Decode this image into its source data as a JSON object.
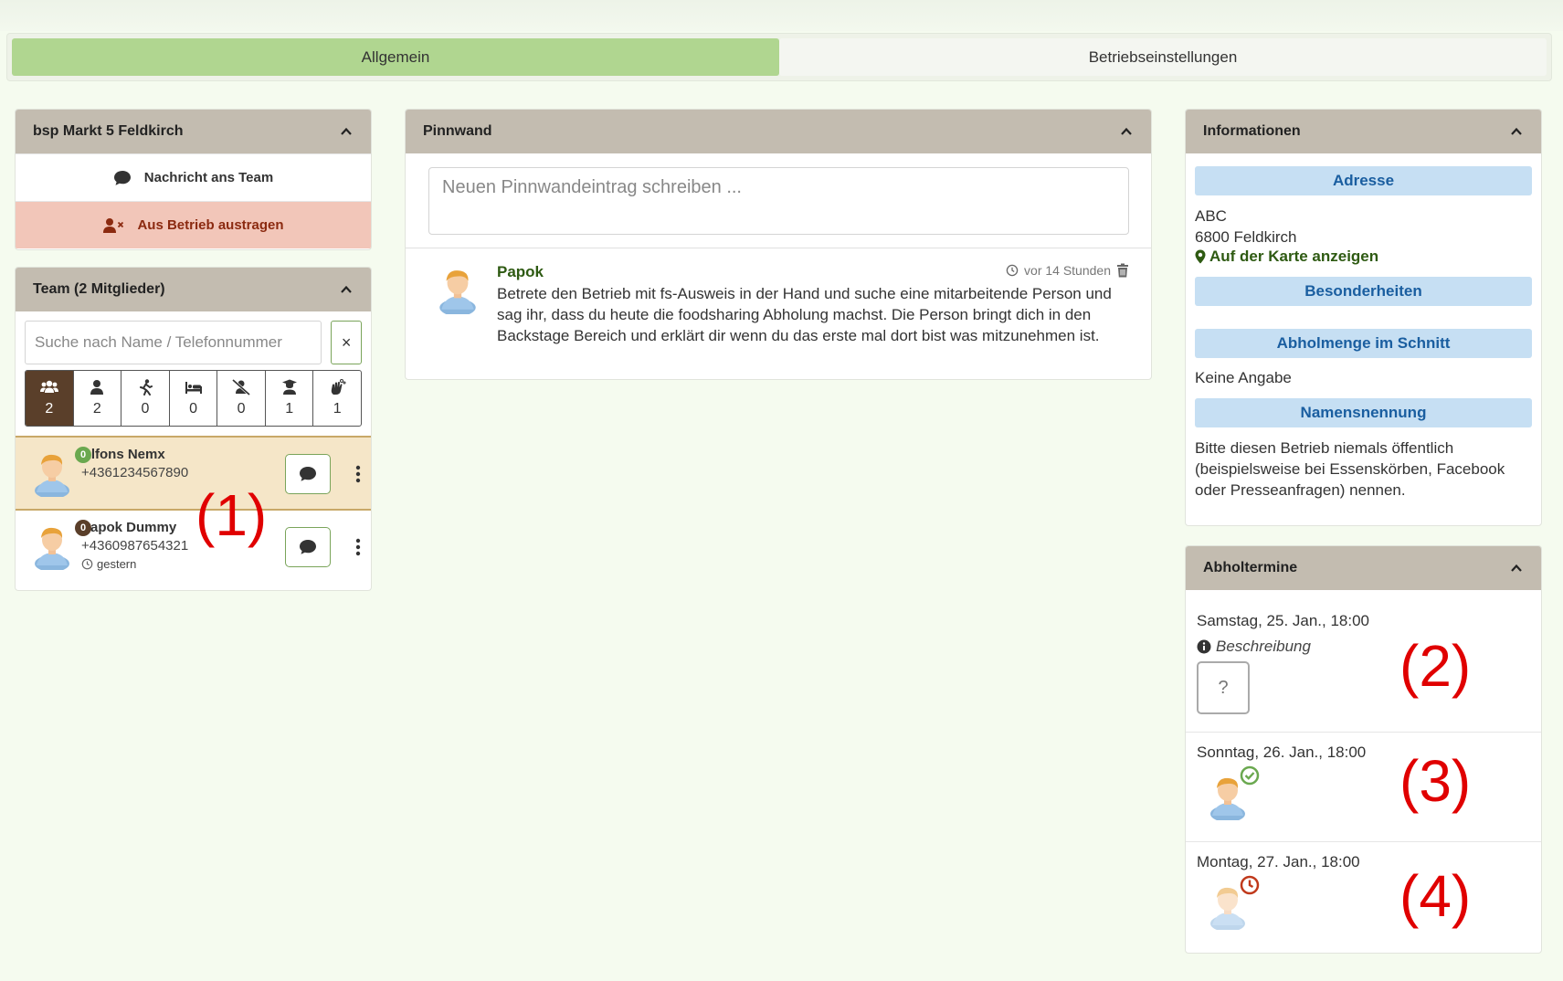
{
  "tabs": [
    {
      "label": "Allgemein",
      "active": true
    },
    {
      "label": "Betriebseinstellungen",
      "active": false
    }
  ],
  "store_panel": {
    "title": "bsp Markt 5 Feldkirch",
    "message_team": "Nachricht ans Team",
    "leave_store": "Aus Betrieb austragen"
  },
  "team_panel": {
    "title": "Team (2 Mitglieder)",
    "search_placeholder": "Suche nach Name / Telefonnummer",
    "clear_label": "×",
    "filters": [
      {
        "icon": "group-icon",
        "count": "2",
        "active": true
      },
      {
        "icon": "person-icon",
        "count": "2",
        "active": false
      },
      {
        "icon": "running-icon",
        "count": "0",
        "active": false
      },
      {
        "icon": "bed-icon",
        "count": "0",
        "active": false
      },
      {
        "icon": "user-slash-icon",
        "count": "0",
        "active": false
      },
      {
        "icon": "user-graduate-icon",
        "count": "1",
        "active": false
      },
      {
        "icon": "hands-wash-icon",
        "count": "1",
        "active": false
      }
    ],
    "members": [
      {
        "name": "Alfons Nemx",
        "phone": "+4361234567890",
        "badge": "0",
        "badge_color": "#6aa84f",
        "last_seen": ""
      },
      {
        "name": "Papok Dummy",
        "phone": "+4360987654321",
        "badge": "0",
        "badge_color": "#5a3f2a",
        "last_seen": "gestern"
      }
    ]
  },
  "pinnwand": {
    "title": "Pinnwand",
    "placeholder": "Neuen Pinnwandeintrag schreiben ...",
    "posts": [
      {
        "author": "Papok",
        "time": "vor 14 Stunden",
        "text": "Betrete den Betrieb mit fs-Ausweis in der Hand und suche eine mitarbeitende Person und sag ihr, dass du heute die foodsharing Abholung machst. Die Person bringt dich in den Backstage Bereich und erklärt dir wenn du das erste mal dort bist was mitzunehmen ist."
      }
    ]
  },
  "info_panel": {
    "title": "Informationen",
    "address_title": "Adresse",
    "address_line1": "ABC",
    "address_line2": "6800 Feldkirch",
    "map_link": "Auf der Karte anzeigen",
    "specials_title": "Besonderheiten",
    "amount_title": "Abholmenge im Schnitt",
    "amount_value": "Keine Angabe",
    "naming_title": "Namensnennung",
    "naming_text": "Bitte diesen Betrieb niemals öffentlich (beispielsweise bei Essenskörben, Facebook oder Presseanfragen) nennen."
  },
  "pickups_panel": {
    "title": "Abholtermine",
    "slots": [
      {
        "date": "Samstag, 25. Jan., 18:00",
        "description": "Beschreibung",
        "state": "empty",
        "slot_label": "?"
      },
      {
        "date": "Sonntag, 26. Jan., 18:00",
        "description": "",
        "state": "confirmed"
      },
      {
        "date": "Montag, 27. Jan., 18:00",
        "description": "",
        "state": "pending"
      }
    ]
  },
  "annotations": [
    "(1)",
    "(2)",
    "(3)",
    "(4)"
  ],
  "colors": {
    "accent_green": "#b0d690",
    "header_taupe": "#c3bcb0",
    "danger_bg": "#f2c6b9",
    "info_blue": "#c6dff3",
    "annotation_red": "#e00000"
  }
}
